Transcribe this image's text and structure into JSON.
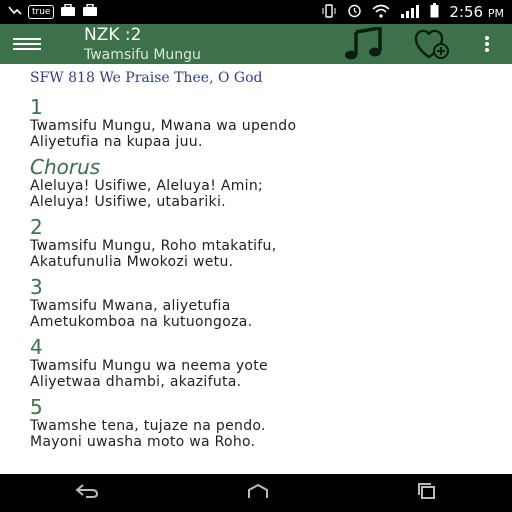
{
  "status_bar": {
    "carrier": "true",
    "time": "2:56",
    "ampm": "PM"
  },
  "header": {
    "title": "NZK :2",
    "subtitle": "Twamsifu Mungu"
  },
  "hymn": {
    "title": "SFW 818 We Praise Thee, O God",
    "blocks": [
      {
        "label": "1",
        "lines": [
          "Twamsifu Mungu, Mwana wa upendo",
          "Aliyetufia na kupaa juu."
        ]
      },
      {
        "label": "Chorus",
        "lines": [
          "Aleluya! Usifiwe, Aleluya! Amin;",
          "Aleluya! Usifiwe, utabariki."
        ]
      },
      {
        "label": "2",
        "lines": [
          "Twamsifu Mungu, Roho mtakatifu,",
          "Akatufunulia Mwokozi wetu."
        ]
      },
      {
        "label": "3",
        "lines": [
          "Twamsifu Mwana, aliyetufia",
          "Ametukomboa na kutuongoza."
        ]
      },
      {
        "label": "4",
        "lines": [
          "Twamsifu Mungu wa neema yote",
          "Aliyetwaa dhambi, akazifuta."
        ]
      },
      {
        "label": "5",
        "lines": [
          "Twamshe tena, tujaze na pendo.",
          "Mayoni uwasha moto wa Roho."
        ]
      }
    ]
  },
  "colors": {
    "appbar": "#3d7149",
    "accent": "#3d7149",
    "title_blue": "#2c3e8c"
  }
}
